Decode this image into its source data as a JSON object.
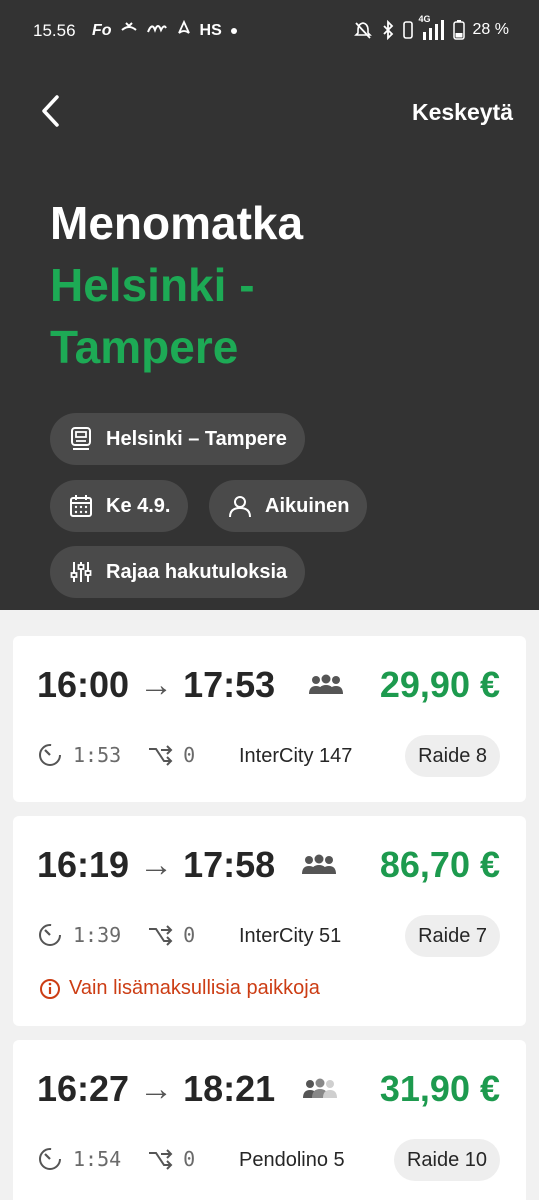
{
  "status_bar": {
    "time": "15.56",
    "apps": [
      "Fo",
      "HS"
    ],
    "network": "4G",
    "battery": "28 %"
  },
  "header": {
    "cancel_label": "Keskeytä",
    "title": "Menomatka",
    "route_line1": "Helsinki -",
    "route_line2": "Tampere"
  },
  "filters": {
    "route": "Helsinki – Tampere",
    "date": "Ke 4.9.",
    "passenger": "Aikuinen",
    "refine": "Rajaa hakutuloksia"
  },
  "results": [
    {
      "depart": "16:00",
      "arrive": "17:53",
      "price": "29,90 €",
      "duration": "1:53",
      "transfers": "0",
      "train": "InterCity 147",
      "track": "Raide 8",
      "warning": ""
    },
    {
      "depart": "16:19",
      "arrive": "17:58",
      "price": "86,70 €",
      "duration": "1:39",
      "transfers": "0",
      "train": "InterCity 51",
      "track": "Raide 7",
      "warning": "Vain lisämaksullisia paikkoja"
    },
    {
      "depart": "16:27",
      "arrive": "18:21",
      "price": "31,90 €",
      "duration": "1:54",
      "transfers": "0",
      "train": "Pendolino 5",
      "track": "Raide 10",
      "warning": ""
    }
  ],
  "colors": {
    "header_bg": "#333333",
    "accent_green": "#1daa55",
    "price_green": "#1d9a4e",
    "warning": "#cc3d14"
  }
}
